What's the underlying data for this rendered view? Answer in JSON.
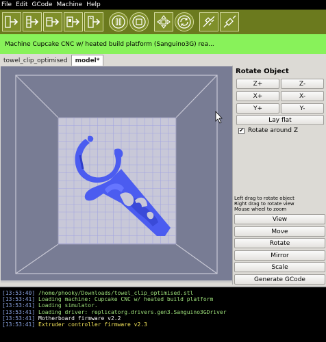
{
  "menu": [
    "File",
    "Edit",
    "GCode",
    "Machine",
    "Help"
  ],
  "toolbar": {
    "buttons": [
      "build-icon",
      "simulate-icon",
      "file-build-icon",
      "file-simulate-icon",
      "upload-icon",
      "pause-icon",
      "stop-icon",
      "control-panel-icon",
      "reset-icon",
      "disconnect-icon",
      "connect-icon"
    ]
  },
  "status": {
    "text": "Machine Cupcake CNC w/ heated build platform (Sanguino3G) rea..."
  },
  "tabs": [
    {
      "label": "towel_clip_optimised",
      "active": false
    },
    {
      "label": "model*",
      "active": true
    }
  ],
  "panel": {
    "title": "Rotate Object",
    "rotate": {
      "zplus": "Z+",
      "zminus": "Z-",
      "xplus": "X+",
      "xminus": "X-",
      "yplus": "Y+",
      "yminus": "Y-"
    },
    "lay_flat": "Lay flat",
    "rotate_around_z": "Rotate around Z",
    "rotate_around_z_checked": true,
    "help": [
      "Left drag to rotate object",
      "Right drag to rotate view",
      "Mouse wheel to zoom"
    ],
    "actions": [
      "View",
      "Move",
      "Rotate",
      "Mirror",
      "Scale",
      "Generate GCode"
    ]
  },
  "console": [
    {
      "ts": "[13:53:40]",
      "msg": "/home/phooky/Downloads/towel_clip_optimised.stl",
      "color": "green"
    },
    {
      "ts": "[13:53:41]",
      "msg": "Loading machine: Cupcake CNC w/ heated build platform",
      "color": "green"
    },
    {
      "ts": "[13:53:41]",
      "msg": "Loading simulator.",
      "color": "green"
    },
    {
      "ts": "[13:53:41]",
      "msg": "Loading driver: replicatorg.drivers.gen3.Sanguino3GDriver",
      "color": "green"
    },
    {
      "ts": "[13:53:41]",
      "msg": "Motherboard firmware v2.2",
      "color": "white"
    },
    {
      "ts": "[13:53:41]",
      "msg": "Extruder controller firmware v2.3",
      "color": "yellow"
    }
  ],
  "colors": {
    "toolbar": "#6b7a1e",
    "status": "#88f25a",
    "viewport": "#787c94",
    "model": "#4b5cf0",
    "platform": "#c8c8d8"
  }
}
